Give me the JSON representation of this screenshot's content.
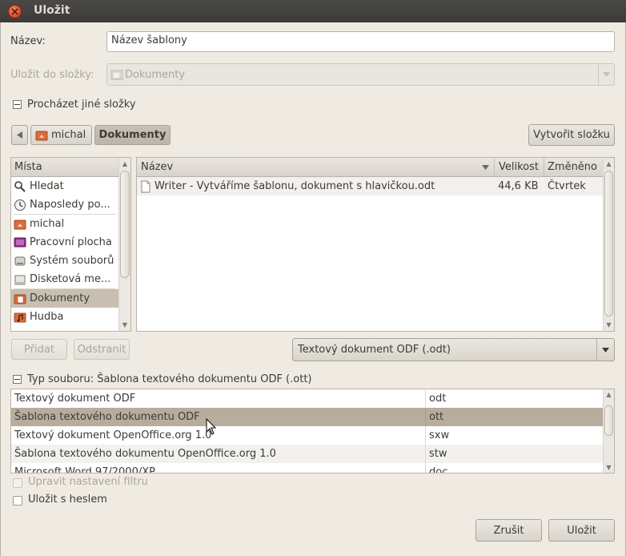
{
  "window": {
    "title": "Uložit"
  },
  "name_field": {
    "label": "Název:",
    "value": "Název šablony"
  },
  "save_in": {
    "label": "Uložit do složky:",
    "value": "Dokumenty"
  },
  "browse_expander": {
    "label": "Procházet jiné složky"
  },
  "path_bar": {
    "segments": [
      "michal",
      "Dokumenty"
    ],
    "create_folder_label": "Vytvořit složku"
  },
  "places": {
    "header": "Místa",
    "items": [
      {
        "label": "Hledat",
        "icon": "search-icon"
      },
      {
        "label": "Naposledy po...",
        "icon": "recent-icon"
      },
      {
        "label": "michal",
        "icon": "home-folder-icon"
      },
      {
        "label": "Pracovní plocha",
        "icon": "desktop-icon"
      },
      {
        "label": "Systém souborů",
        "icon": "drive-icon"
      },
      {
        "label": "Disketová me...",
        "icon": "floppy-icon"
      },
      {
        "label": "Dokumenty",
        "icon": "documents-folder-icon"
      },
      {
        "label": "Hudba",
        "icon": "music-folder-icon"
      }
    ],
    "add_label": "Přidat",
    "remove_label": "Odstranit"
  },
  "files": {
    "columns": {
      "name": "Název",
      "size": "Velikost",
      "modified": "Změněno"
    },
    "rows": [
      {
        "name": "Writer - Vytváříme šablonu, dokument s hlavičkou.odt",
        "size": "44,6 KB",
        "modified": "Čtvrtek"
      }
    ]
  },
  "filter": {
    "value": "Textový dokument ODF (.odt)"
  },
  "file_type": {
    "label": "Typ souboru: Šablona textového dokumentu ODF (.ott)",
    "rows": [
      {
        "name": "Textový dokument ODF",
        "ext": "odt"
      },
      {
        "name": "Šablona textového dokumentu ODF",
        "ext": "ott"
      },
      {
        "name": "Textový dokument OpenOffice.org 1.0",
        "ext": "sxw"
      },
      {
        "name": "Šablona textového dokumentu OpenOffice.org 1.0",
        "ext": "stw"
      },
      {
        "name": "Microsoft Word 97/2000/XP",
        "ext": "doc"
      }
    ]
  },
  "options": {
    "edit_filter_label": "Upravit nastavení filtru",
    "password_label": "Uložit s heslem"
  },
  "actions": {
    "cancel_label": "Zrušit",
    "save_label": "Uložit"
  },
  "colors": {
    "accent": "#c9bfb1",
    "titlebar": "#3c3b37",
    "close": "#e0502a"
  }
}
